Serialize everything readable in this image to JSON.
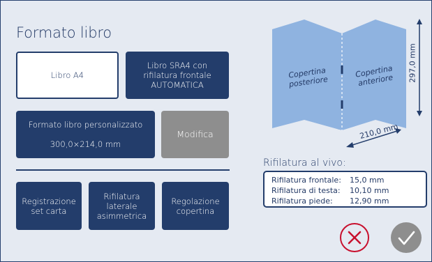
{
  "page": {
    "title": "Formato libro"
  },
  "format_buttons": {
    "a4": "Libro A4",
    "sra4": "Libro SRA4 con\nrifilatura frontale\nAUTOMATICA",
    "custom_label": "Formato libro personalizzato",
    "custom_size": "300,0×214,0 mm",
    "edit": "Modifica"
  },
  "bottom_buttons": {
    "paper_set": "Registrazione\nset carta",
    "asym_trim": "Rifilatura\nlaterale\nasimmetrica",
    "cover_adjust": "Regolazione\ncopertina"
  },
  "diagram": {
    "back_cover": "Copertina\nposteriore",
    "front_cover": "Copertina\nanteriore",
    "height": "297,0 mm",
    "width": "210,0 mm"
  },
  "trim": {
    "title": "Rifilatura al vivo:",
    "rows": [
      {
        "label": "Rifilatura frontale:",
        "value": "15,0 mm"
      },
      {
        "label": "Rifilatura di testa:",
        "value": "10,10 mm"
      },
      {
        "label": "Rifilatura piede:",
        "value": "12,90 mm"
      }
    ]
  },
  "colors": {
    "accent": "#233d6b",
    "background": "#e5eaf2",
    "cover_fill": "#8fb3e0",
    "cancel": "#c8102e",
    "disabled": "#8e8e8e"
  },
  "icons": {
    "cancel": "close-icon",
    "confirm": "check-icon"
  }
}
